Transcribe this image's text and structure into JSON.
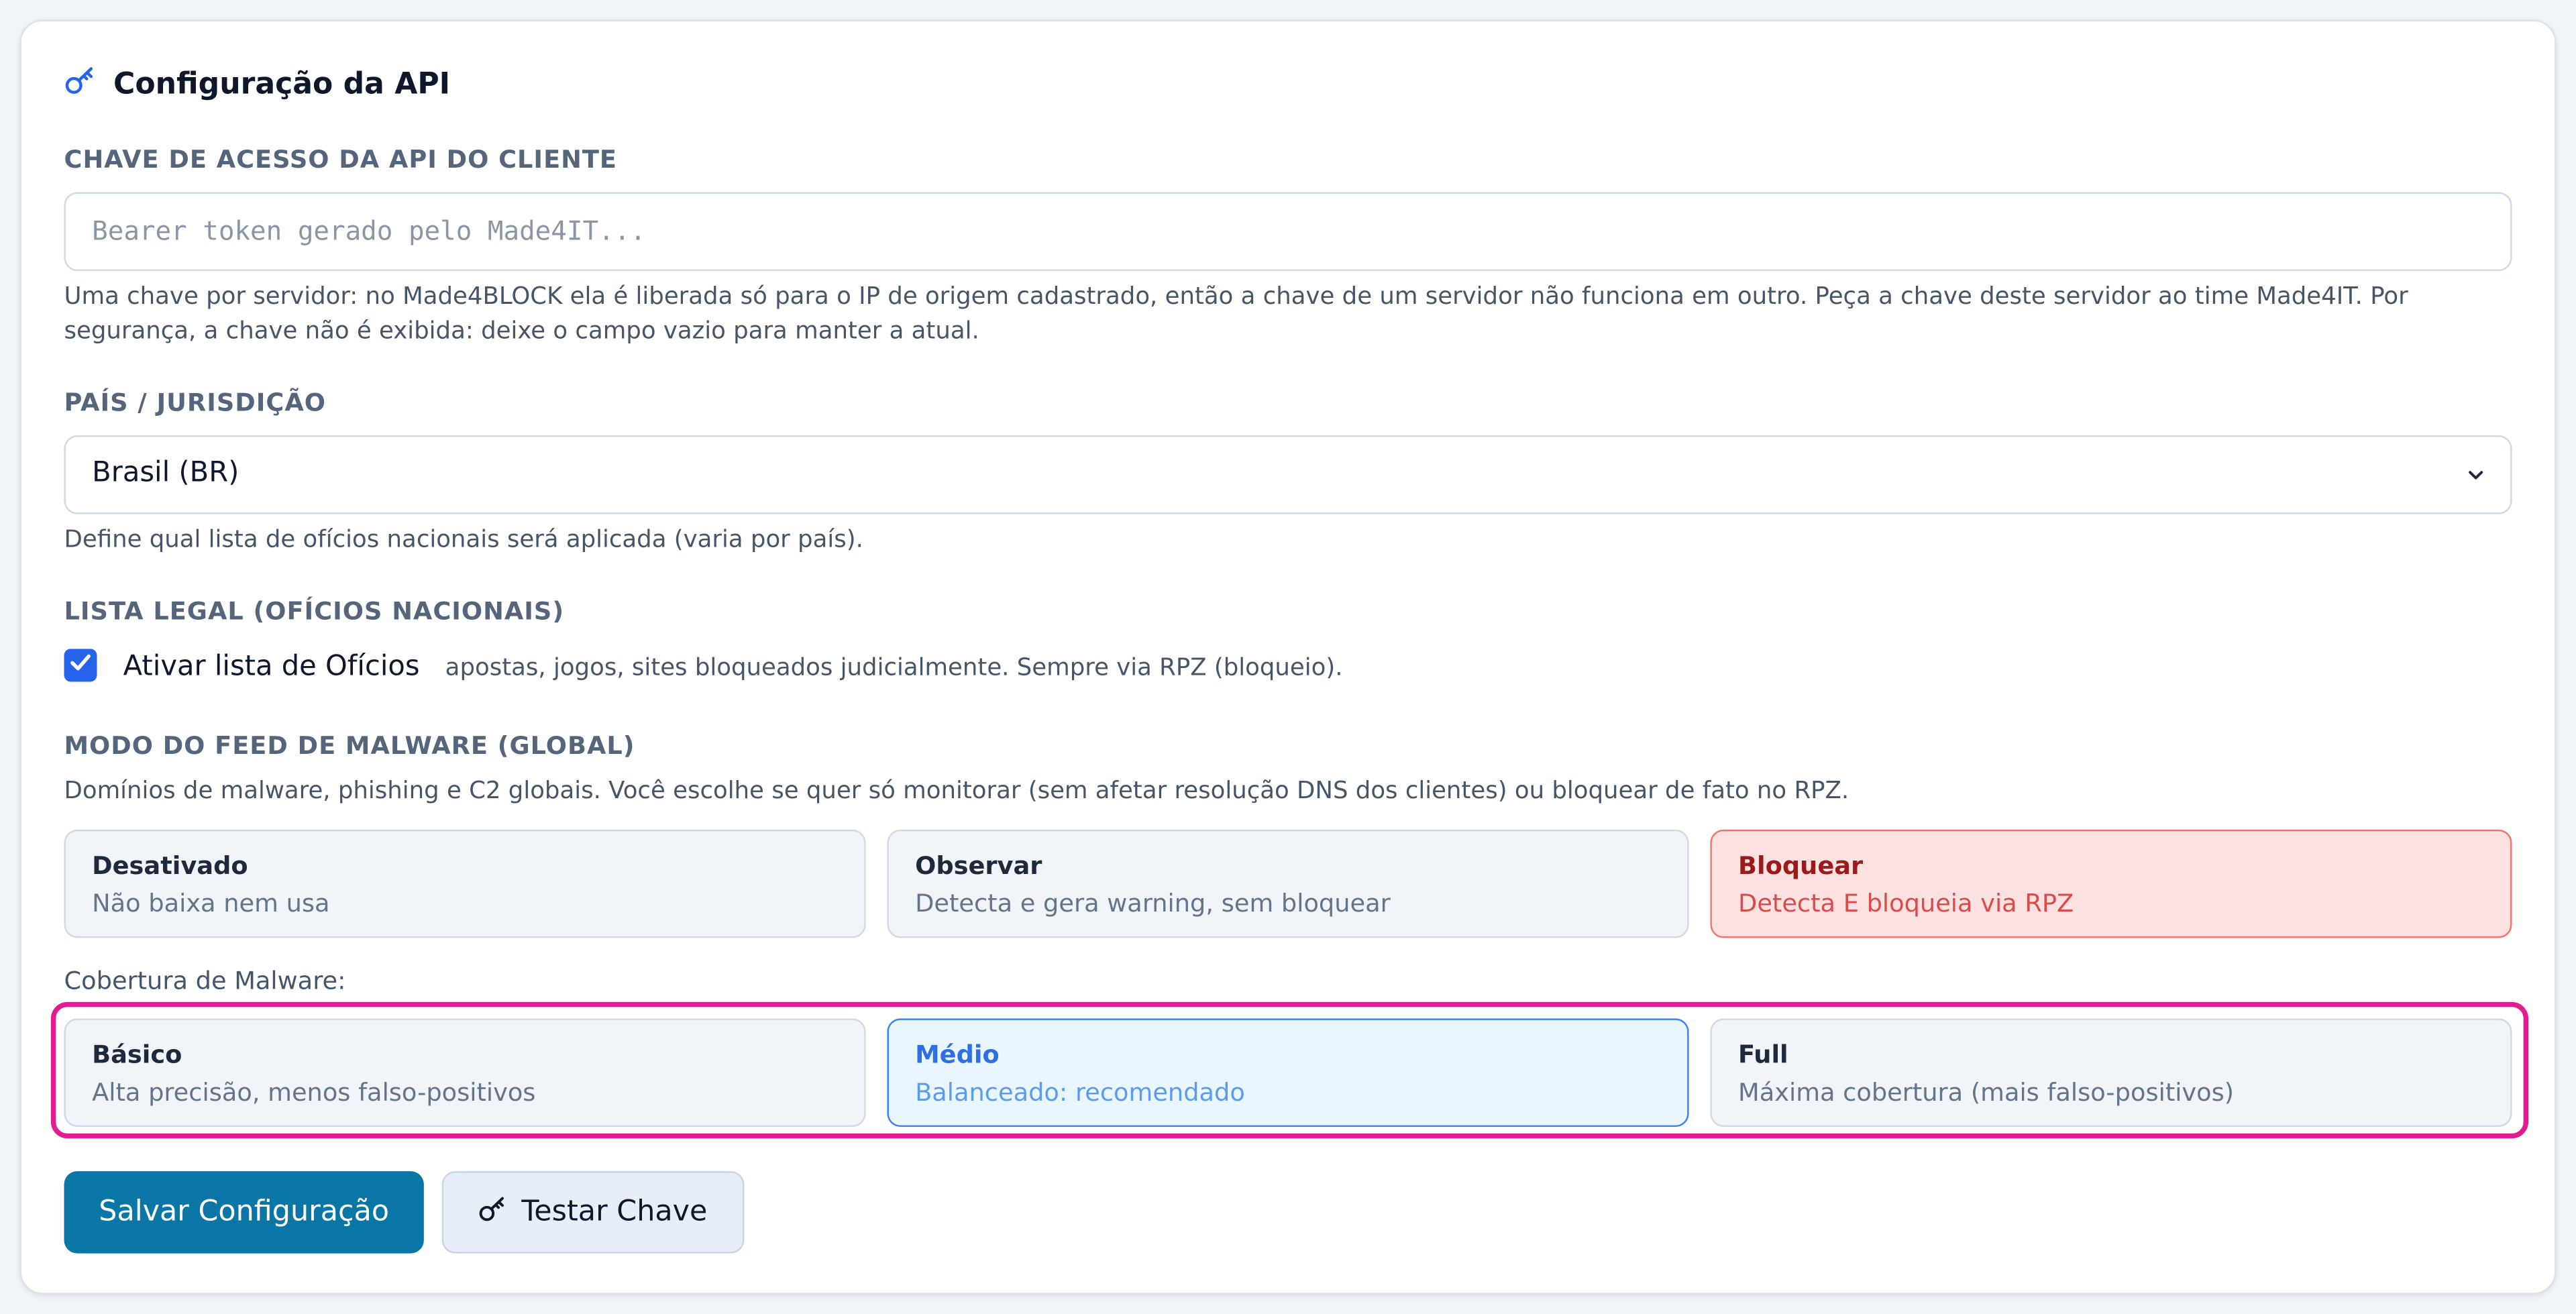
{
  "card": {
    "title": "Configuração da API"
  },
  "api_key": {
    "label": "CHAVE DE ACESSO DA API DO CLIENTE",
    "placeholder": "Bearer token gerado pelo Made4IT...",
    "value": "",
    "help_line1": "Uma chave por servidor: no Made4BLOCK ela é liberada só para o IP de origem cadastrado, então a chave de um servidor não funciona em outro. Peça a chave deste servidor ao time Made4IT. Por",
    "help_line2": "segurança, a chave não é exibida: deixe o campo vazio para manter a atual."
  },
  "country": {
    "label": "PAÍS / JURISDIÇÃO",
    "selected": "Brasil (BR)",
    "help": "Define qual lista de ofícios nacionais será aplicada (varia por país)."
  },
  "legal_list": {
    "label": "LISTA LEGAL (OFÍCIOS NACIONAIS)",
    "checkbox_label": "Ativar lista de Ofícios",
    "checked": true,
    "description": "apostas, jogos, sites bloqueados judicialmente. Sempre via RPZ (bloqueio)."
  },
  "malware_mode": {
    "label": "MODO DO FEED DE MALWARE (GLOBAL)",
    "help": "Domínios de malware, phishing e C2 globais. Você escolhe se quer só monitorar (sem afetar resolução DNS dos clientes) ou bloquear de fato no RPZ.",
    "options": [
      {
        "title": "Desativado",
        "desc": "Não baixa nem usa"
      },
      {
        "title": "Observar",
        "desc": "Detecta e gera warning, sem bloquear"
      },
      {
        "title": "Bloquear",
        "desc": "Detecta E bloqueia via RPZ"
      }
    ],
    "selected": "Bloquear"
  },
  "coverage": {
    "label": "Cobertura de Malware:",
    "options": [
      {
        "title": "Básico",
        "desc": "Alta precisão, menos falso-positivos"
      },
      {
        "title": "Médio",
        "desc": "Balanceado: recomendado"
      },
      {
        "title": "Full",
        "desc": "Máxima cobertura (mais falso-positivos)"
      }
    ],
    "selected": "Médio"
  },
  "actions": {
    "save_label": "Salvar Configuração",
    "test_label": "Testar Chave"
  },
  "colors": {
    "primary": "#0a76a6",
    "danger": "#991b1b",
    "accent": "#2f6fe4",
    "highlight": "#e01e8f"
  },
  "icons": {
    "title": "key-icon",
    "test": "key-icon",
    "select": "chevron-down-icon",
    "checkbox": "check-icon"
  }
}
